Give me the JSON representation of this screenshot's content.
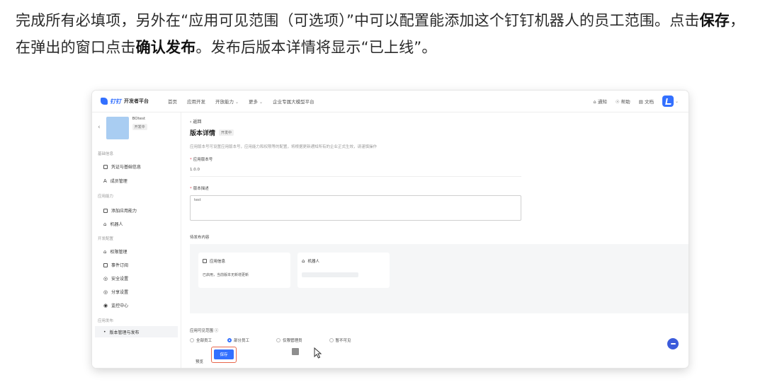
{
  "instruction": {
    "part1": "完成所有必填项，另外在“应用可见范围（可选项）”中可以配置能添加这个钉钉机器人的员工范围。点击",
    "save_bold": "保存",
    "part2": "，在弹出的窗口点击",
    "confirm_bold": "确认发布",
    "part3": "。发布后版本详情将显示“已上线”。"
  },
  "topnav": {
    "logo_text": "钉钉",
    "logo_subtitle": "开发者平台",
    "items": [
      "首页",
      "应用开发",
      "开放能力",
      "更多",
      "企业专属大模型平台"
    ],
    "right_items": [
      "通知",
      "帮助",
      "文档"
    ]
  },
  "sidebar": {
    "app_name": "BOtest",
    "app_status": "开发中",
    "sections": [
      {
        "title": "基础信息",
        "items": [
          "凭证与基础信息",
          "成员管理"
        ]
      },
      {
        "title": "应用能力",
        "items": [
          "添加应用能力",
          "机器人"
        ]
      },
      {
        "title": "开发配置",
        "items": [
          "权限管理",
          "事件订阅",
          "安全设置",
          "分享设置",
          "监控中心"
        ]
      },
      {
        "title": "应用发布",
        "items": [
          "版本管理与发布"
        ]
      }
    ]
  },
  "main": {
    "back_label": "返回",
    "title": "版本详情",
    "title_badge": "开发中",
    "hint": "应用版本号可设置应用版本号，应用能力和权限等的配置，将根据更新通知所有的企业正式生效，请谨慎操作",
    "version_label": "应用版本号",
    "version_value": "1.0.0",
    "desc_label": "版本描述",
    "desc_value": "test",
    "publish_label": "待发布内容",
    "card1_title": "应用信息",
    "card1_desc": "已启用，当前版本无新增更新",
    "card2_title": "机器人",
    "visibility_label": "应用可见范围",
    "radio_options": [
      "全部员工",
      "部分员工",
      "仅限管理员",
      "暂不可见"
    ],
    "selected_option": "部分员工",
    "preview_label": "预览",
    "save_label": "保存"
  },
  "colors": {
    "accent": "#3370ff",
    "highlight": "#e8674c"
  }
}
